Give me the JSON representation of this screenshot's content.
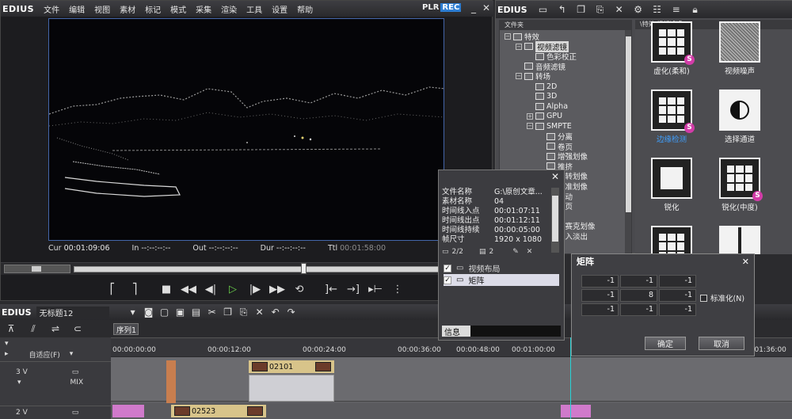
{
  "app": {
    "logo": "EDIUS",
    "menu": [
      "文件",
      "编辑",
      "视图",
      "素材",
      "标记",
      "模式",
      "采集",
      "渲染",
      "工具",
      "设置",
      "帮助"
    ],
    "plr": "PLR",
    "rec": "REC",
    "accent_color": "#2d7dd2"
  },
  "player": {
    "timecodes": [
      {
        "label": "Cur",
        "value": "00:01:09:06",
        "dim": false
      },
      {
        "label": "In",
        "value": "--:--:--:--",
        "dim": false
      },
      {
        "label": "Out",
        "value": "--:--:--:--",
        "dim": false
      },
      {
        "label": "Dur",
        "value": "--:--:--:--",
        "dim": false
      },
      {
        "label": "Ttl",
        "value": "00:01:58:00",
        "dim": true
      }
    ]
  },
  "bin": {
    "logo": "EDIUS",
    "folder_header": "文件夹",
    "effects_header": "\\特效\\视频滤镜",
    "tree": [
      {
        "label": "特效",
        "indent": 0,
        "toggle": "−",
        "selected": false
      },
      {
        "label": "视频滤镜",
        "indent": 1,
        "toggle": "−",
        "selected": true
      },
      {
        "label": "色彩校正",
        "indent": 2,
        "toggle": "",
        "selected": false
      },
      {
        "label": "音频滤镜",
        "indent": 1,
        "toggle": "",
        "selected": false
      },
      {
        "label": "转场",
        "indent": 1,
        "toggle": "−",
        "selected": false
      },
      {
        "label": "2D",
        "indent": 2,
        "toggle": "",
        "selected": false
      },
      {
        "label": "3D",
        "indent": 2,
        "toggle": "",
        "selected": false
      },
      {
        "label": "Alpha",
        "indent": 2,
        "toggle": "",
        "selected": false
      },
      {
        "label": "GPU",
        "indent": 2,
        "toggle": "+",
        "selected": false
      },
      {
        "label": "SMPTE",
        "indent": 2,
        "toggle": "−",
        "selected": false
      },
      {
        "label": "分离",
        "indent": 3,
        "toggle": "",
        "selected": false
      },
      {
        "label": "卷页",
        "indent": 3,
        "toggle": "",
        "selected": false
      },
      {
        "label": "增强划像",
        "indent": 3,
        "toggle": "",
        "selected": false
      },
      {
        "label": "推挤",
        "indent": 3,
        "toggle": "",
        "selected": false
      },
      {
        "label": "旋转划像",
        "indent": 3,
        "toggle": "",
        "selected": false
      },
      {
        "label": "系准划像",
        "indent": 3,
        "toggle": "",
        "selected": false
      },
      {
        "label": "滑动",
        "indent": 3,
        "toggle": "",
        "selected": false
      },
      {
        "label": "翻页",
        "indent": 3,
        "toggle": "",
        "selected": false
      },
      {
        "label": "门",
        "indent": 3,
        "toggle": "",
        "selected": false
      },
      {
        "label": "马赛克划像",
        "indent": 3,
        "toggle": "",
        "selected": false
      },
      {
        "label": "淡入淡出",
        "indent": 3,
        "toggle": "",
        "selected": false
      }
    ],
    "effects": [
      {
        "name": "虚化(柔和)",
        "highlight": false,
        "badge": "S",
        "art": "grid"
      },
      {
        "name": "视频噪声",
        "highlight": false,
        "badge": "",
        "art": "noise"
      },
      {
        "name": "边缘检测",
        "highlight": true,
        "badge": "S",
        "art": "grid"
      },
      {
        "name": "选择通道",
        "highlight": false,
        "badge": "",
        "art": "channel"
      },
      {
        "name": "锐化",
        "highlight": false,
        "badge": "",
        "art": "square"
      },
      {
        "name": "锐化(中度)",
        "highlight": false,
        "badge": "S",
        "art": "grid"
      },
      {
        "name": "",
        "highlight": false,
        "badge": "",
        "art": "grid"
      },
      {
        "name": "",
        "highlight": false,
        "badge": "",
        "art": "door"
      }
    ],
    "badge_color": "#d23ca8"
  },
  "info_panel": {
    "rows": [
      {
        "k": "文件名称",
        "v": "G:\\原创文章..."
      },
      {
        "k": "素材名称",
        "v": "04"
      },
      {
        "k": "时间线入点",
        "v": "00:01:07:11"
      },
      {
        "k": "时间线出点",
        "v": "00:01:12:11"
      },
      {
        "k": "时间线持续",
        "v": "00:00:05:00"
      },
      {
        "k": "帧尺寸",
        "v": "1920 x 1080"
      }
    ],
    "count": "2/2",
    "layer_count": "2",
    "layers": [
      {
        "label": "视频布局",
        "checked": true,
        "selected": false
      },
      {
        "label": "矩阵",
        "checked": true,
        "selected": true
      }
    ],
    "footer_tab": "信息"
  },
  "matrix_dialog": {
    "title": "矩阵",
    "cells": [
      "-1",
      "-1",
      "-1",
      "-1",
      "8",
      "-1",
      "-1",
      "-1",
      "-1"
    ],
    "normalize_label": "标准化(N)",
    "ok_label": "确定",
    "cancel_label": "取消"
  },
  "timeline": {
    "logo": "EDIUS",
    "project_name": "无标题12",
    "sequence_tab": "序列1",
    "fit_label": "自适应(F)",
    "ruler_ticks": [
      "00:00:00:00",
      "00:00:12:00",
      "00:00:24:00",
      "00:00:36:00",
      "00:00:48:00",
      "00:01:00:00",
      "00:01:36:00"
    ],
    "tracks": [
      {
        "name": "3 V",
        "mix": "MIX"
      },
      {
        "name": "2 V",
        "mix": ""
      }
    ],
    "clips": [
      {
        "label": "02101",
        "track": 0
      },
      {
        "label": "02523",
        "track": 1
      }
    ]
  }
}
